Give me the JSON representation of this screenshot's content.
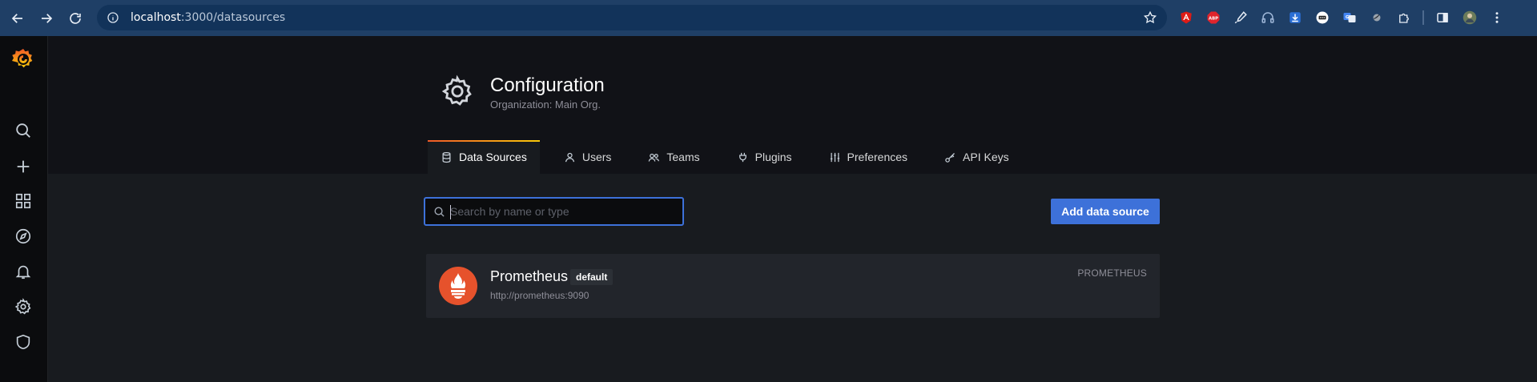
{
  "browser": {
    "url_host": "localhost",
    "url_path": ":3000/datasources"
  },
  "header": {
    "title": "Configuration",
    "subtitle": "Organization: Main Org."
  },
  "tabs": [
    {
      "label": "Data Sources",
      "icon": "database-icon",
      "active": true
    },
    {
      "label": "Users",
      "icon": "user-icon"
    },
    {
      "label": "Teams",
      "icon": "users-icon"
    },
    {
      "label": "Plugins",
      "icon": "plug-icon"
    },
    {
      "label": "Preferences",
      "icon": "sliders-icon"
    },
    {
      "label": "API Keys",
      "icon": "key-icon"
    }
  ],
  "search": {
    "placeholder": "Search by name or type",
    "value": ""
  },
  "actions": {
    "add_label": "Add data source"
  },
  "datasources": [
    {
      "name": "Prometheus",
      "badge": "default",
      "url": "http://prometheus:9090",
      "type": "PROMETHEUS"
    }
  ],
  "colors": {
    "accent": "#3d71d9",
    "tab_gradient_start": "#f05a28",
    "tab_gradient_end": "#fbca0a",
    "prometheus": "#e6522c"
  }
}
